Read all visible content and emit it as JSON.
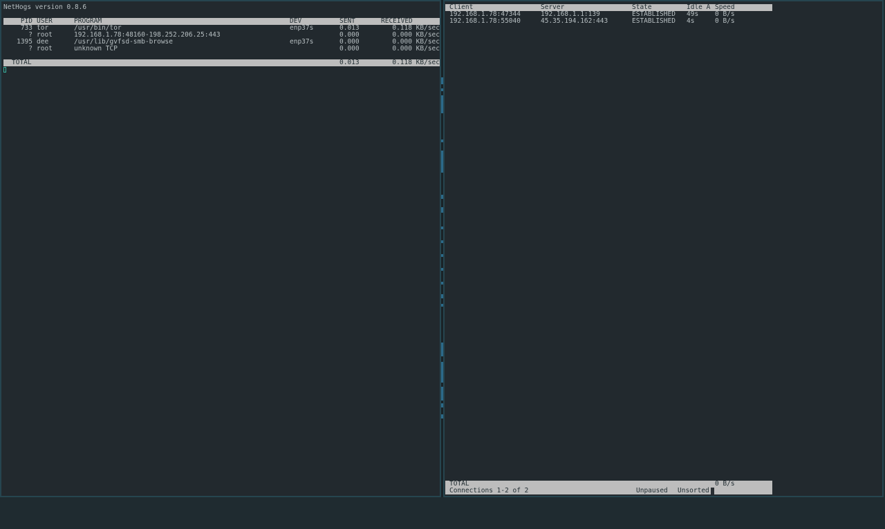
{
  "nethogs": {
    "version_line": "NetHogs version 0.8.6",
    "headers": {
      "pid": "PID",
      "user": "USER",
      "program": "PROGRAM",
      "dev": "DEV",
      "sent": "SENT",
      "received": "RECEIVED"
    },
    "rows": [
      {
        "pid": "733",
        "user": "tor",
        "program": "/usr/bin/tor",
        "dev": "enp37s",
        "sent": "0.013",
        "received": "0.118 KB/sec"
      },
      {
        "pid": "?",
        "user": "root",
        "program": "192.168.1.78:48160-198.252.206.25:443",
        "dev": "",
        "sent": "0.000",
        "received": "0.000 KB/sec"
      },
      {
        "pid": "1395",
        "user": "dee",
        "program": "/usr/lib/gvfsd-smb-browse",
        "dev": "enp37s",
        "sent": "0.000",
        "received": "0.000 KB/sec"
      },
      {
        "pid": "?",
        "user": "root",
        "program": "unknown TCP",
        "dev": "",
        "sent": "0.000",
        "received": "0.000 KB/sec"
      }
    ],
    "total": {
      "label": "TOTAL",
      "sent": "0.013",
      "received": "0.118 KB/sec"
    }
  },
  "tcptrack": {
    "headers": {
      "client": "Client",
      "server": "Server",
      "state": "State",
      "idle": "Idle A",
      "speed": "Speed"
    },
    "rows": [
      {
        "client": "192.168.1.78:47344",
        "server": "192.168.1.1:139",
        "state": "ESTABLISHED",
        "idle": "49s",
        "speed": "0 B/s"
      },
      {
        "client": "192.168.1.78:55040",
        "server": "45.35.194.162:443",
        "state": "ESTABLISHED",
        "idle": "4s",
        "speed": "0 B/s"
      }
    ],
    "total": {
      "label": "TOTAL",
      "speed": "0 B/s"
    },
    "status": {
      "connections": "Connections 1-2 of 2",
      "paused": "Unpaused",
      "sorted": "Unsorted"
    }
  },
  "colors": {
    "background": "#22292e",
    "header_bar": "#bdbdbd",
    "pane_border": "#26454f",
    "cursor": "#39b3a0"
  }
}
